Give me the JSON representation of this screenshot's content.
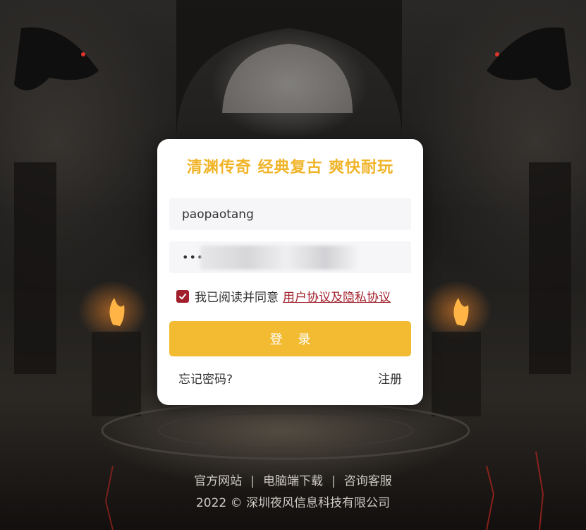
{
  "background": {
    "description_icon": "dungeon-background"
  },
  "card": {
    "slogan": "清渊传奇 经典复古 爽快耐玩",
    "username_value": "paopaotang",
    "password_value": "•••",
    "agree_text": "我已阅读并同意",
    "agree_link": "用户协议及隐私协议",
    "agree_checked": true,
    "login_label": "登 录",
    "forgot_label": "忘记密码?",
    "register_label": "注册"
  },
  "footer": {
    "links": [
      "官方网站",
      "电脑端下载",
      "咨询客服"
    ],
    "separator": "|",
    "copyright": "2022 © 深圳夜风信息科技有限公司"
  },
  "colors": {
    "accent": "#f2bb32",
    "slogan": "#f0b429",
    "link": "#a1202b",
    "checkbox": "#a1202b"
  }
}
